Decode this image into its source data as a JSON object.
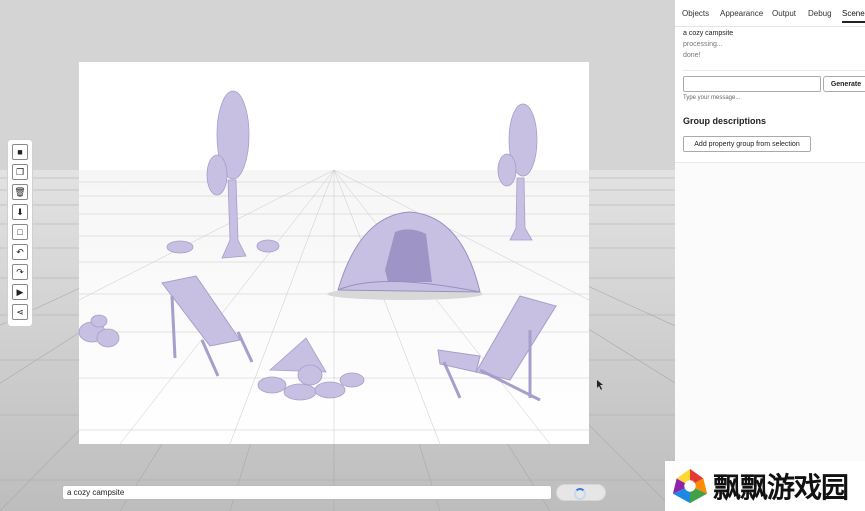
{
  "colors": {
    "accent": "#3a7bd5",
    "model": "#c8c0e2",
    "panel_bg": "#ffffff",
    "sky": "#d4d4d4"
  },
  "toolbar": {
    "tools": [
      {
        "name": "camera-icon",
        "glyph": "■"
      },
      {
        "name": "duplicate-icon",
        "glyph": "❐"
      },
      {
        "name": "trash-icon",
        "glyph": "🗑"
      },
      {
        "name": "download-icon",
        "glyph": "⬇"
      },
      {
        "name": "frame-icon",
        "glyph": "□"
      },
      {
        "name": "undo-icon",
        "glyph": "↶"
      },
      {
        "name": "redo-icon",
        "glyph": "↷"
      },
      {
        "name": "play-icon",
        "glyph": "▶"
      },
      {
        "name": "share-icon",
        "glyph": "⋖"
      }
    ]
  },
  "prompt": {
    "value": "a cozy campsite"
  },
  "panel": {
    "tabs": [
      "Objects",
      "Appearance",
      "Output",
      "Debug",
      "Scene"
    ],
    "active_tab": "Scene",
    "log": [
      "a cozy campsite",
      "processing...",
      "done!"
    ],
    "message_hint": "Type your message...",
    "generate_label": "Generate",
    "section_title": "Group descriptions",
    "add_group_label": "Add property group from selection"
  },
  "watermark": {
    "text": "飘飘游戏园"
  }
}
